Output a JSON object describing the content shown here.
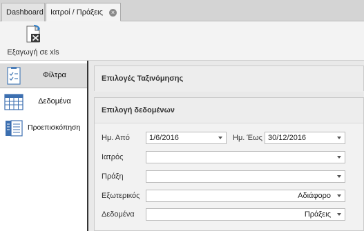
{
  "tabs": [
    {
      "label": "Dashboard"
    },
    {
      "label": "Ιατροί / Πράξεις"
    }
  ],
  "toolbar": {
    "export_label": "Εξαγωγή σε xls"
  },
  "nav": {
    "items": [
      {
        "label": "Φίλτρα",
        "active": true
      },
      {
        "label": "Δεδομένα",
        "active": false
      },
      {
        "label": "Προεπισκόπηση",
        "active": false
      }
    ]
  },
  "sections": {
    "sort_title": "Επιλογές Ταξινόμησης",
    "data_title": "Επιλογή δεδομένων"
  },
  "form": {
    "date_from_label": "Ημ. Από",
    "date_from_value": "1/6/2016",
    "date_to_label": "Ημ. Έως",
    "date_to_value": "30/12/2016",
    "doctor_label": "Ιατρός",
    "doctor_value": "",
    "action_label": "Πράξη",
    "action_value": "",
    "external_label": "Εξωτερικός",
    "external_value": "Αδιάφορο",
    "data_label": "Δεδομένα",
    "data_value": "Πράξεις"
  },
  "colors": {
    "accent": "#333333",
    "nav_active_bg": "#dcdcdc",
    "panel_bg": "#f2f2f2"
  }
}
